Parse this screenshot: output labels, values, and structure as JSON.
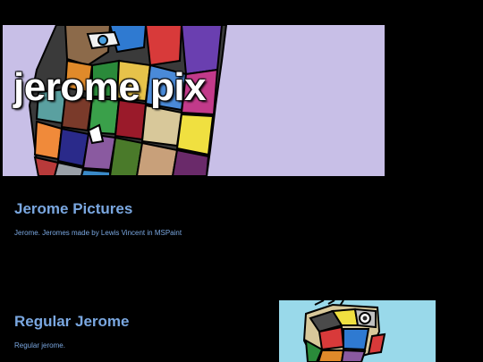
{
  "site": {
    "title": "jerome pix"
  },
  "colors": {
    "page_background": "#000000",
    "banner_background": "#c8bfe7",
    "heading_color": "#7aa7e0",
    "thumbnail_background": "#99d9ea"
  },
  "banner": {
    "image": "jerome-portrait-illustration"
  },
  "gallery": {
    "heading": "Jerome Pictures",
    "description": "Jerome. Jeromes made by Lewis Vincent in MSPaint"
  },
  "regular": {
    "heading": "Regular Jerome",
    "description": "Regular jerome.",
    "image": "regular-jerome-illustration"
  }
}
